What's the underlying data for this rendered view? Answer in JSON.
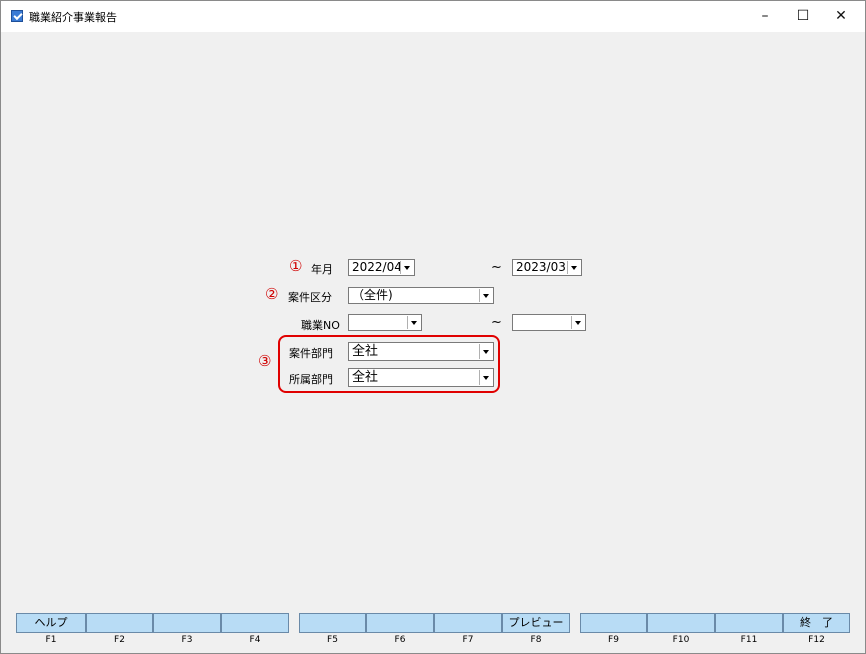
{
  "window": {
    "title": "職業紹介事業報告",
    "minimize": "–",
    "maximize": "☐",
    "close": "✕"
  },
  "form": {
    "markers": [
      "①",
      "②",
      "③"
    ],
    "year_month": {
      "label": "年月",
      "from": "2022/04",
      "tilde": "~",
      "to": "2023/03"
    },
    "case_category": {
      "label": "案件区分",
      "value": "（全件)"
    },
    "job_no": {
      "label": "職業NO",
      "from": "",
      "tilde": "~",
      "to": ""
    },
    "case_department": {
      "label": "案件部門",
      "value": "全社"
    },
    "affiliation_department": {
      "label": "所属部門",
      "value": "全社"
    }
  },
  "fkeys": [
    {
      "label": "ヘルプ",
      "key": "F1"
    },
    {
      "label": "",
      "key": "F2"
    },
    {
      "label": "",
      "key": "F3"
    },
    {
      "label": "",
      "key": "F4"
    },
    {
      "label": "",
      "key": "F5"
    },
    {
      "label": "",
      "key": "F6"
    },
    {
      "label": "",
      "key": "F7"
    },
    {
      "label": "プレビュー",
      "key": "F8"
    },
    {
      "label": "",
      "key": "F9"
    },
    {
      "label": "",
      "key": "F10"
    },
    {
      "label": "",
      "key": "F11"
    },
    {
      "label": "終　了",
      "key": "F12"
    }
  ],
  "colors": {
    "fkey_bg": "#b8dcf5",
    "highlight_red": "#e00000",
    "background": "#f0f0f0"
  }
}
